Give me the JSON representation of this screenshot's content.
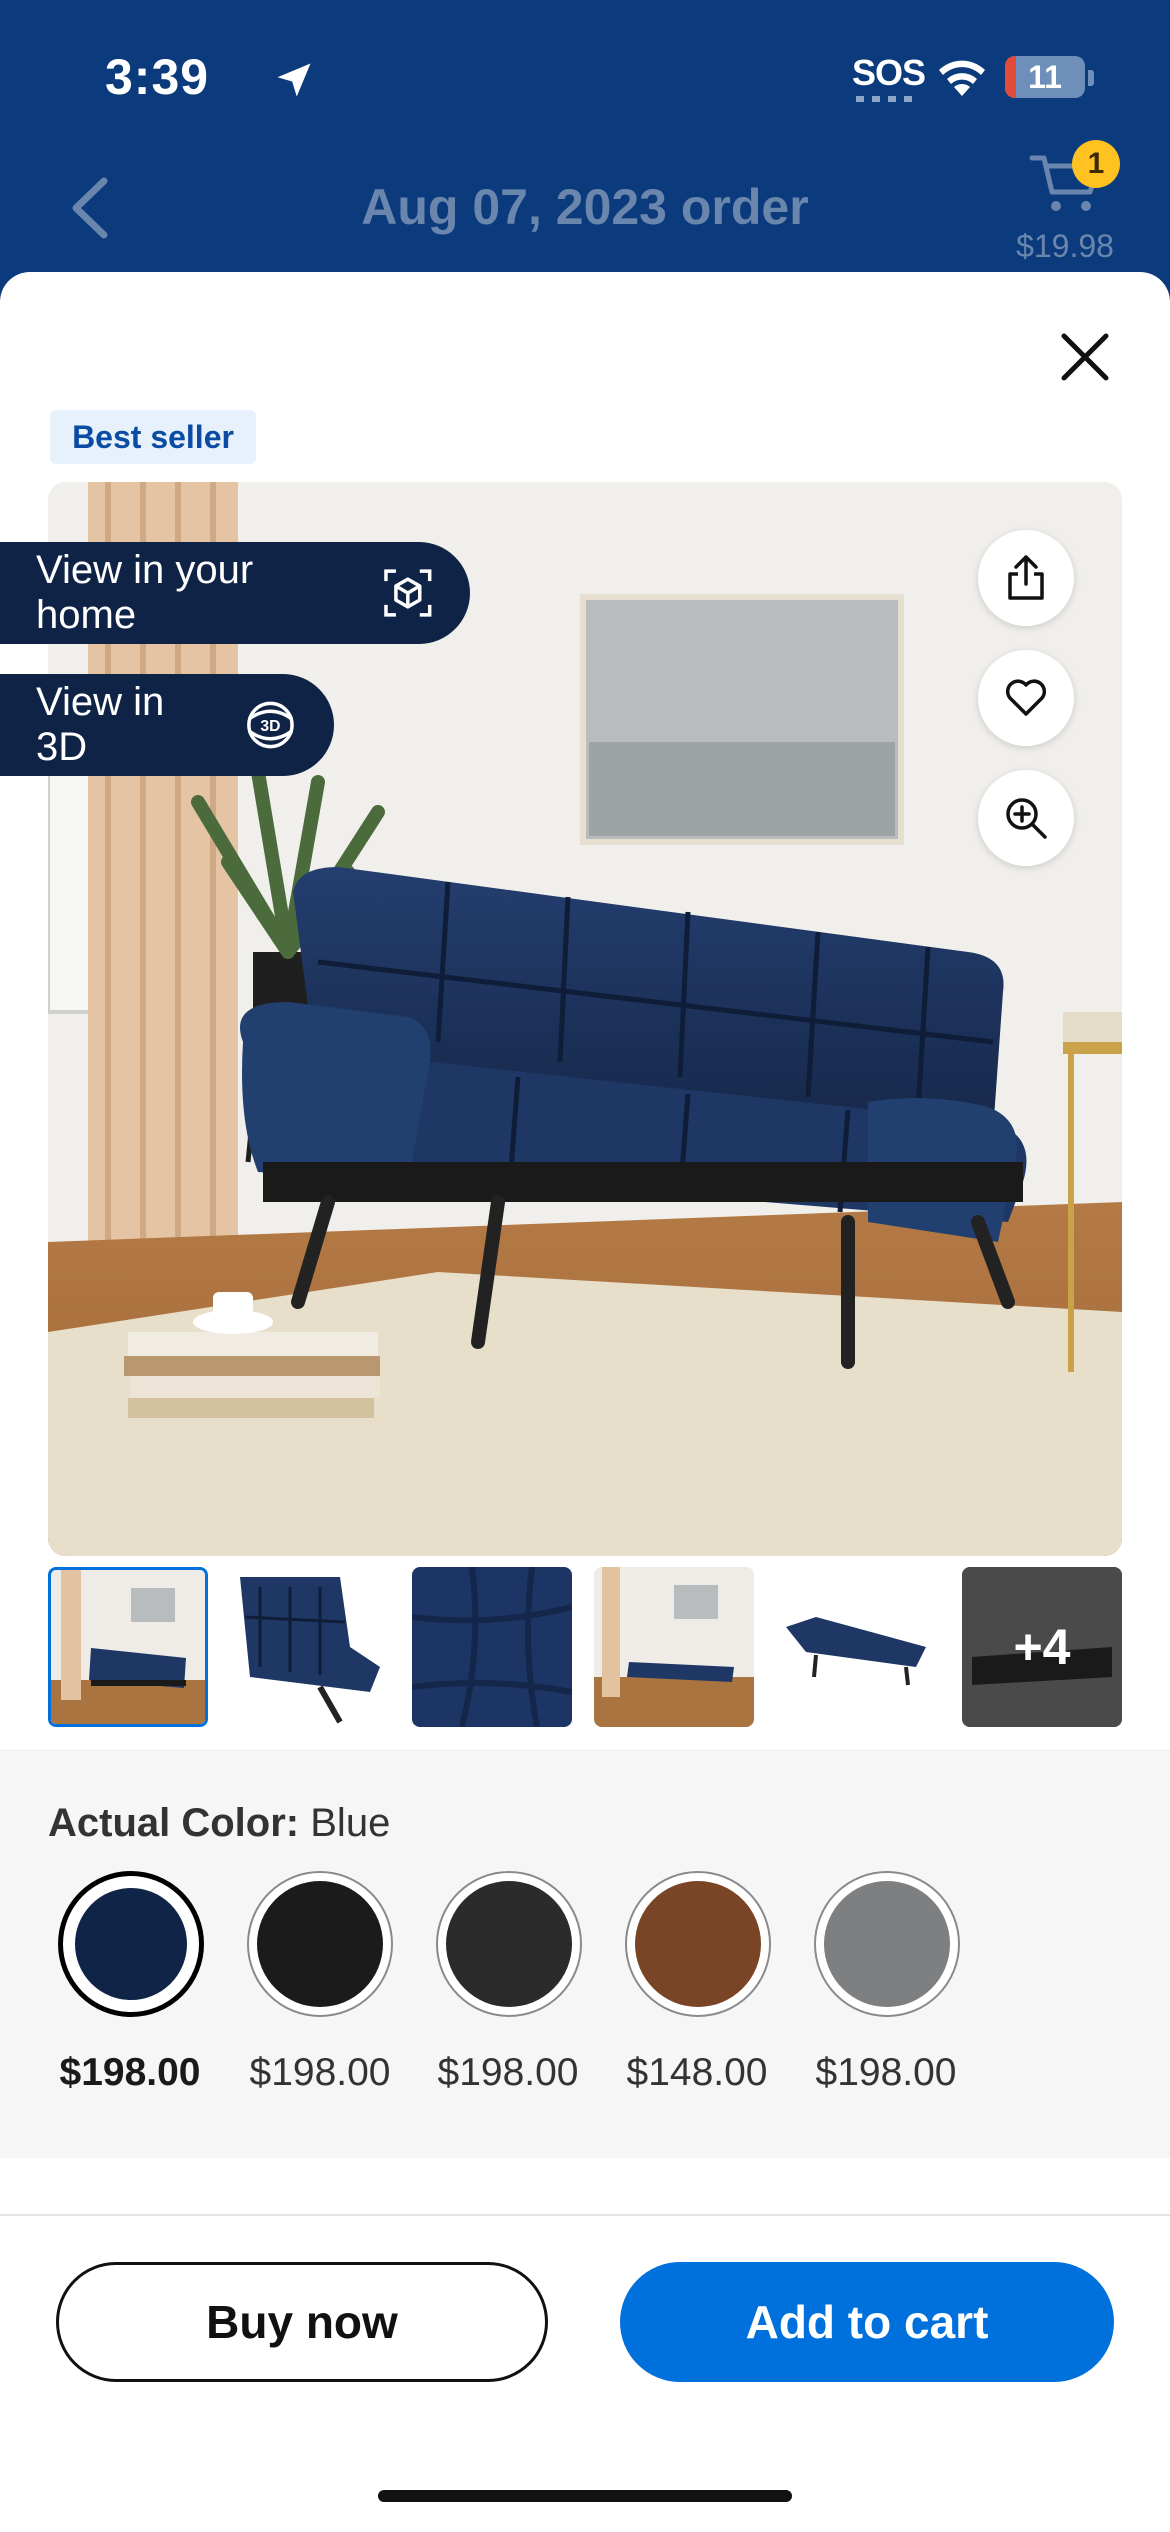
{
  "status_bar": {
    "time": "3:39",
    "sos": "SOS",
    "battery": "11",
    "battery_level_percent": 11
  },
  "header": {
    "title": "Aug 07, 2023 order",
    "cart_count": "1",
    "cart_total": "$19.98"
  },
  "product": {
    "badge": "Best seller",
    "view_in_home_label": "View in your home",
    "view_in_3d_label": "View in 3D",
    "more_thumbs_label": "+4"
  },
  "colors": {
    "label": "Actual Color:",
    "selected": "Blue",
    "options": [
      {
        "color": "#102447",
        "price": "$198.00"
      },
      {
        "color": "#1b1b1b",
        "price": "$198.00"
      },
      {
        "color": "#2b2b2b",
        "price": "$198.00"
      },
      {
        "color": "#7a4526",
        "price": "$148.00"
      },
      {
        "color": "#7d7f80",
        "price": "$198.00"
      }
    ]
  },
  "actions": {
    "buy_now": "Buy now",
    "add_to_cart": "Add to cart"
  },
  "theme": {
    "header_blue": "#0b3b7c",
    "primary_blue": "#0071dc",
    "badge_yellow": "#ffc220"
  }
}
